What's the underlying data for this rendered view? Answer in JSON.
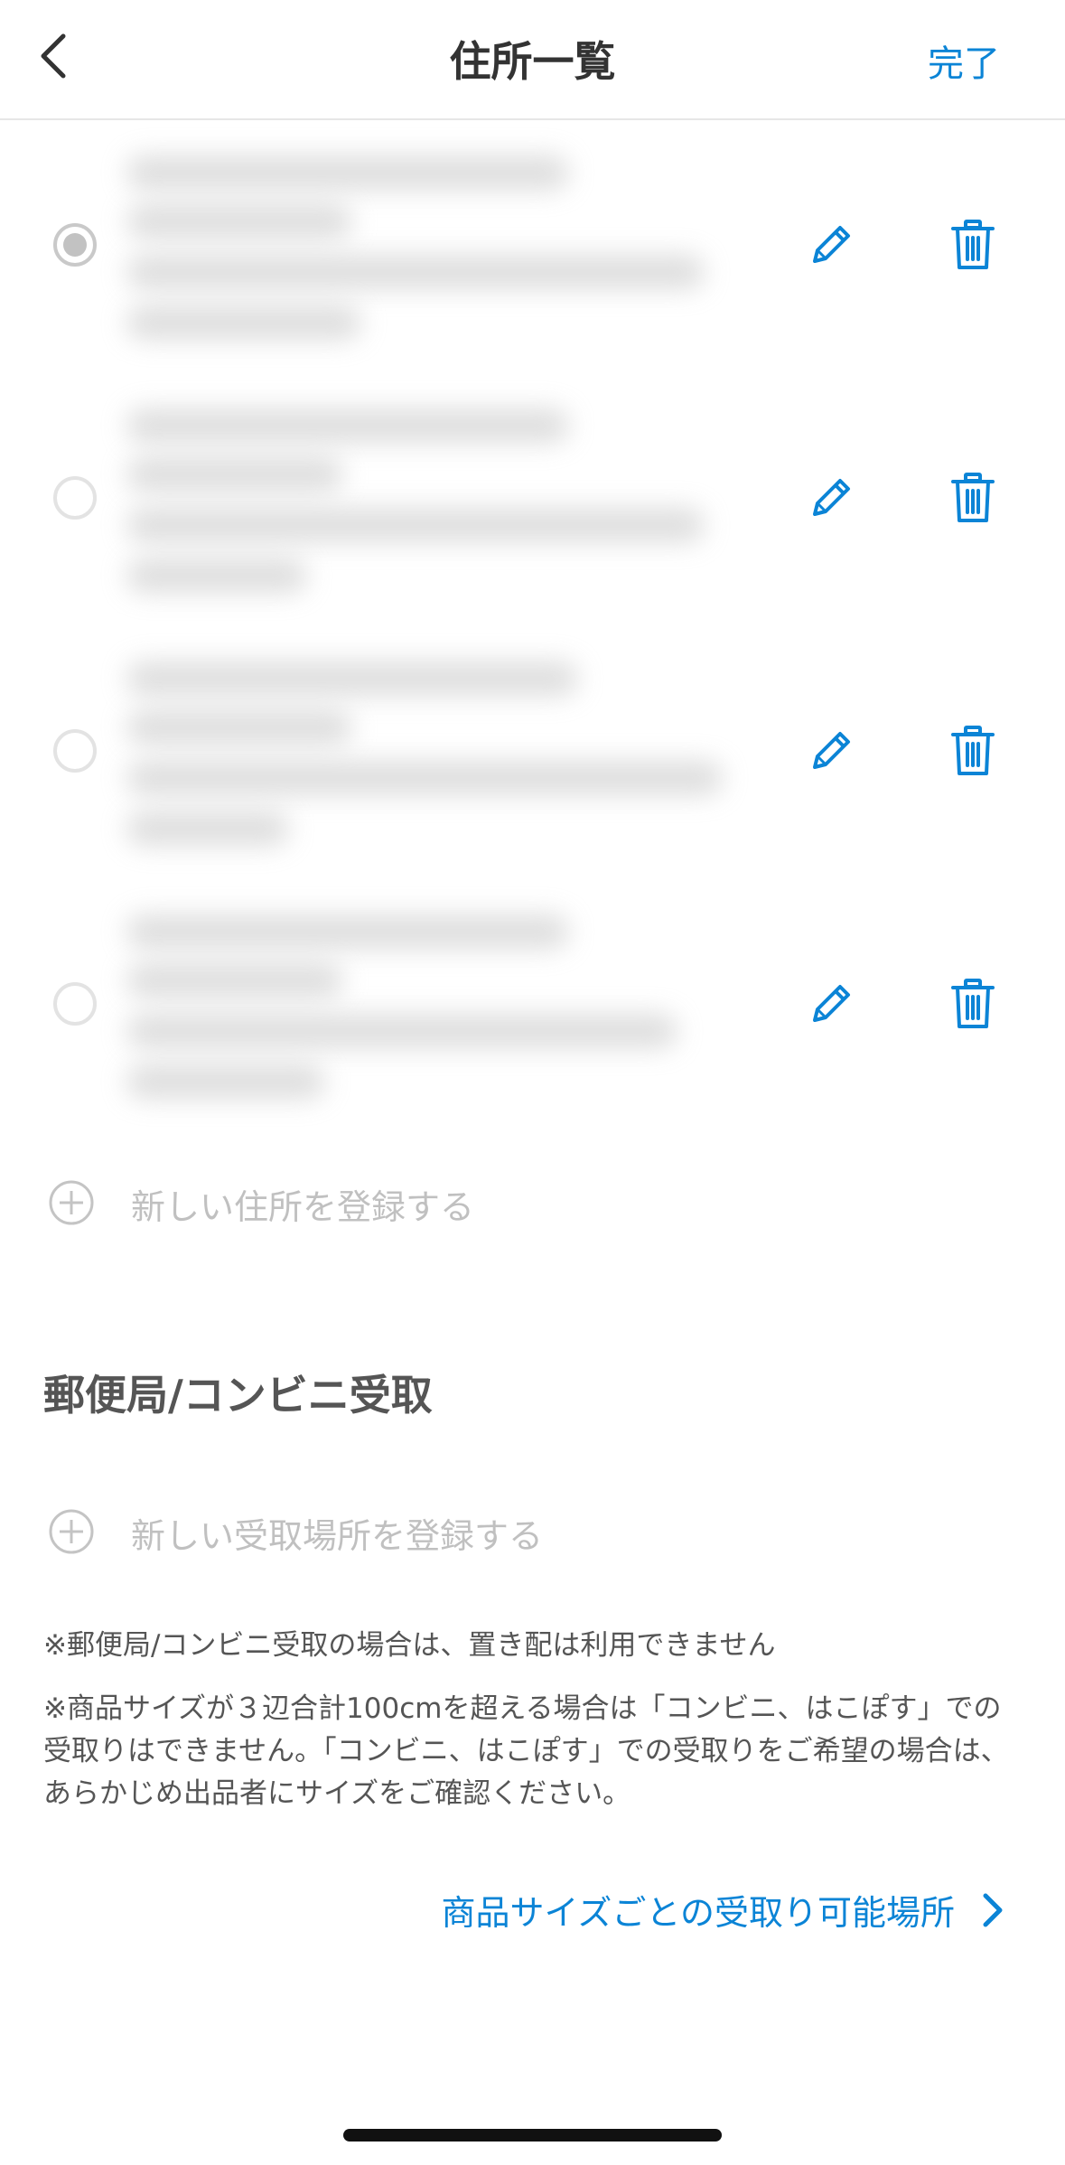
{
  "header": {
    "title": "住所一覧",
    "done_label": "完了"
  },
  "addresses": [
    {
      "selected": true
    },
    {
      "selected": false
    },
    {
      "selected": false
    },
    {
      "selected": false
    }
  ],
  "add_address_label": "新しい住所を登録する",
  "pickup_section": {
    "title": "郵便局/コンビニ受取",
    "add_label": "新しい受取場所を登録する"
  },
  "notes": [
    "※郵便局/コンビニ受取の場合は、置き配は利用できません",
    "※商品サイズが３辺合計100cmを超える場合は「コンビニ、はこぽす」での受取りはできません。「コンビニ、はこぽす」での受取りをご希望の場合は、あらかじめ出品者にサイズをご確認ください。"
  ],
  "size_link_label": "商品サイズごとの受取り可能場所",
  "colors": {
    "accent": "#0b84d6",
    "muted_text": "#c0c0c0",
    "body_text": "#555555"
  }
}
